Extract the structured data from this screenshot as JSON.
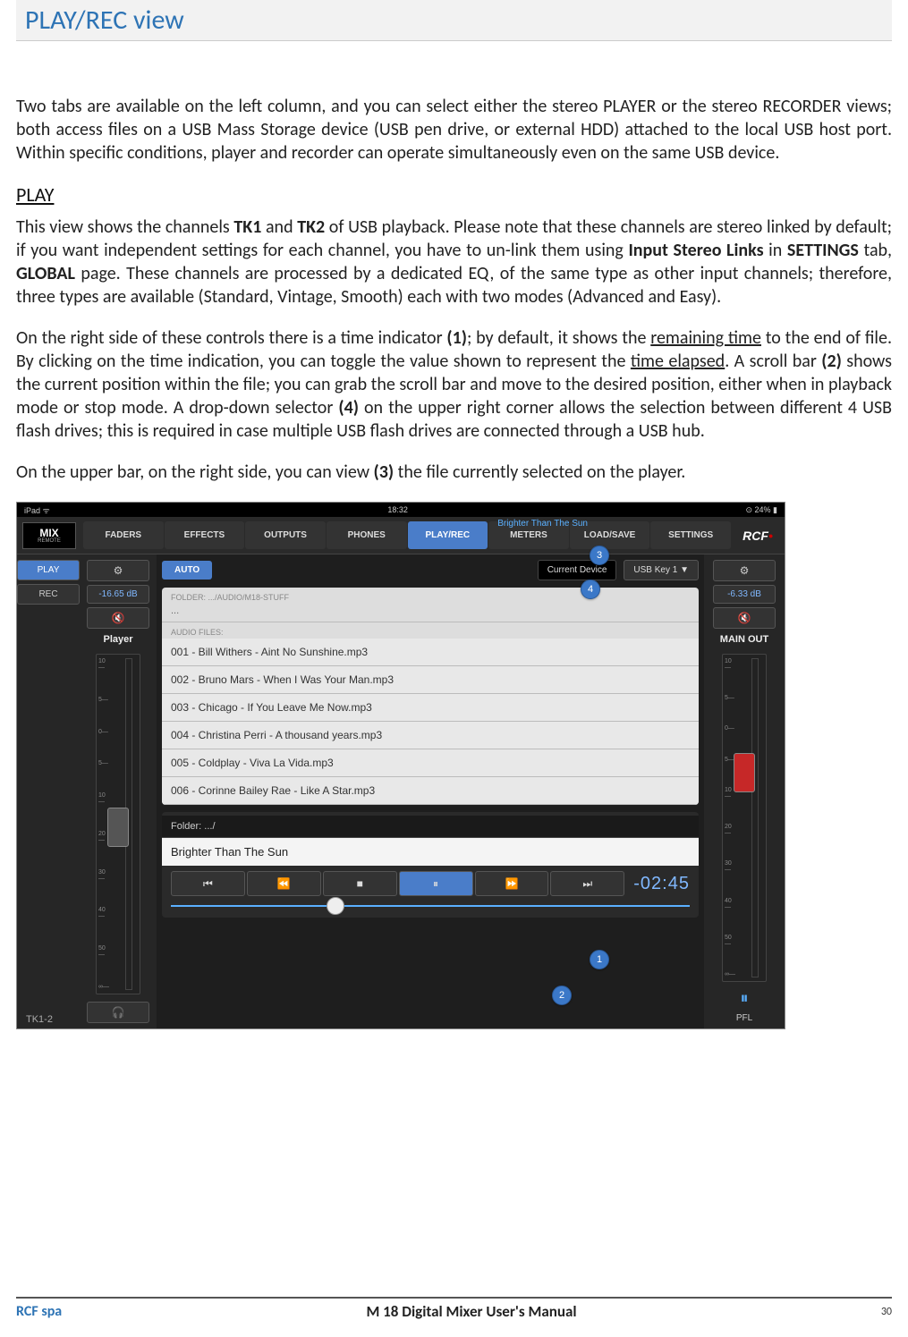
{
  "section_title": "PLAY/REC view",
  "intro_para": "Two tabs are available on the left column, and you can select either the stereo PLAYER or the stereo RECORDER views; both access  files on a USB Mass Storage device (USB pen drive, or external HDD) attached to the local USB host port. Within specific conditions, player and recorder can operate simultaneously even on the same USB device.",
  "play_heading": "PLAY",
  "play_p1_a": "This view shows the channels ",
  "play_p1_tk1": "TK1",
  "play_p1_b": " and ",
  "play_p1_tk2": "TK2",
  "play_p1_c": " of USB playback. Please note that these channels are stereo linked by default; if you want independent settings for each channel, you have to un-link them using ",
  "play_p1_isl": "Input Stereo Links",
  "play_p1_d": " in ",
  "play_p1_settings": "SETTINGS",
  "play_p1_e": " tab, ",
  "play_p1_global": "GLOBAL",
  "play_p1_f": " page.  These channels are processed by a dedicated EQ, of the same type as other input channels; therefore, three types are available (Standard, Vintage, Smooth) each with two modes (Advanced and Easy).",
  "play_p2_a": "On the right side of these controls there is a time indicator ",
  "play_p2_1": "(1)",
  "play_p2_b": "; by default, it shows the ",
  "play_p2_rt": "remaining time",
  "play_p2_c": " to the end of file. By clicking on the time indication, you can toggle the value shown to represent the ",
  "play_p2_te": "time elapsed",
  "play_p2_d": ". A scroll bar ",
  "play_p2_2": "(2)",
  "play_p2_e": " shows the current position within the file; you can grab the scroll bar and move to the desired position, either when in playback mode or stop mode. A drop-down selector ",
  "play_p2_4": "(4)",
  "play_p2_f": " on the upper right corner allows the selection between different 4 USB flash drives; this is required in case multiple USB flash drives are connected through a USB hub.",
  "play_p3_a": "On the upper bar, on the right side, you can view ",
  "play_p3_3": "(3)",
  "play_p3_b": " the file currently selected on the player.",
  "ipad": {
    "label": "iPad",
    "time": "18:32",
    "battery": "24%"
  },
  "logo_main": "MIX",
  "logo_sub": "REMOTE",
  "tabs": [
    "FADERS",
    "EFFECTS",
    "OUTPUTS",
    "PHONES",
    "PLAY/REC",
    "METERS",
    "LOAD/SAVE",
    "SETTINGS"
  ],
  "rcf": "RCF",
  "header_song": "Brighter Than The Sun",
  "left": {
    "play": "PLAY",
    "rec": "REC",
    "db": "-16.65 dB",
    "player": "Player",
    "tk": "TK1-2"
  },
  "right": {
    "db": "-6.33 dB",
    "main": "MAIN OUT",
    "pfl": "PFL"
  },
  "mid": {
    "auto": "AUTO",
    "device": "Current Device",
    "usb": "USB Key 1  ▼",
    "folder_h": "FOLDER:  .../AUDIO/M18-STUFF",
    "dots": "...",
    "files_h": "AUDIO FILES:",
    "files": [
      "001 - Bill Withers - Aint No Sunshine.mp3",
      "002 - Bruno Mars - When I Was Your Man.mp3",
      "003 - Chicago - If You Leave Me Now.mp3",
      "004 - Christina Perri - A thousand years.mp3",
      "005 - Coldplay - Viva La Vida.mp3",
      "006 - Corinne Bailey Rae - Like A Star.mp3"
    ],
    "folder_row": "Folder: .../",
    "current": "Brighter Than The Sun",
    "time": "-02:45"
  },
  "scale": [
    "10—",
    "5—",
    "0—",
    "5—",
    "10—",
    "20—",
    "30—",
    "40—",
    "50—",
    "∞—"
  ],
  "callouts": {
    "c1": "1",
    "c2": "2",
    "c3": "3",
    "c4": "4"
  },
  "footer": {
    "left": "RCF spa",
    "mid": "M 18 Digital Mixer User's Manual",
    "right": "30"
  }
}
